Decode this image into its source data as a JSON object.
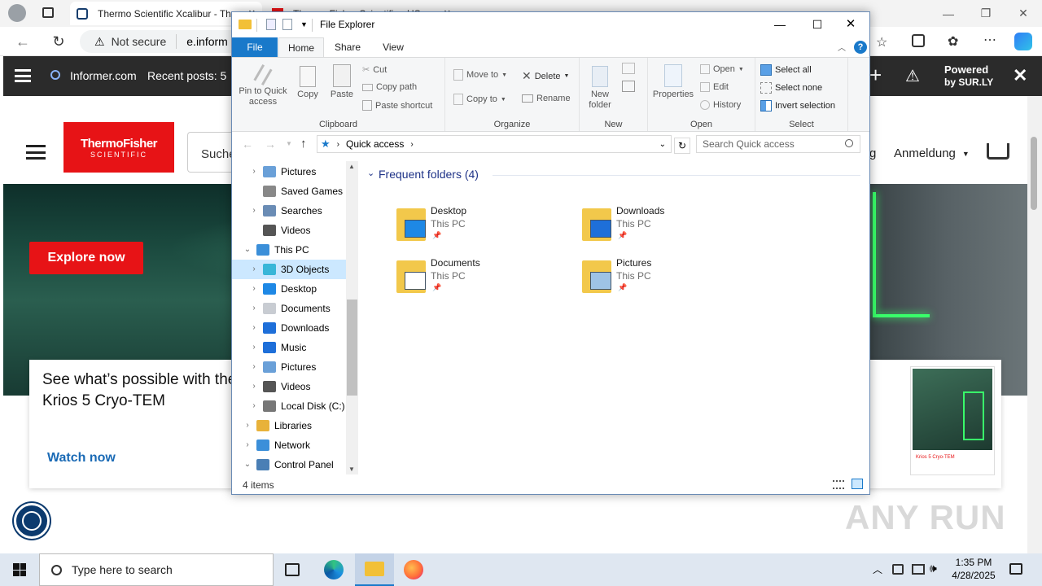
{
  "browser": {
    "tabs": [
      {
        "title": "Thermo Scientific Xcalibur - Th"
      },
      {
        "title": "Thermo Fisher Scientific - US"
      }
    ],
    "address": {
      "warning": "Not secure",
      "url": "e.inform"
    },
    "informer_bar": {
      "site": "Informer.com",
      "recent": "Recent posts: 5",
      "powered_line1": "Powered",
      "powered_line2": "by SUR.LY"
    },
    "site": {
      "logo_line1": "ThermoFisher",
      "logo_line2": "SCIENTIFIC",
      "search_placeholder": "Suche",
      "link_partial": "g",
      "signin": "Anmeldung",
      "hero_button": "Explore now",
      "card_title": "See what’s possible with the Krios 5 Cryo-TEM",
      "card_link": "Watch now",
      "product_caption": "Krios 5 Cryo-TEM"
    },
    "watermark": "ANY RUN"
  },
  "explorer": {
    "title": "File Explorer",
    "tabs": [
      "File",
      "Home",
      "Share",
      "View"
    ],
    "ribbon": {
      "clipboard": {
        "label": "Clipboard",
        "pin": "Pin to Quick access",
        "copy": "Copy",
        "paste": "Paste",
        "cut": "Cut",
        "copy_path": "Copy path",
        "paste_shortcut": "Paste shortcut"
      },
      "organize": {
        "label": "Organize",
        "move_to": "Move to",
        "copy_to": "Copy to",
        "delete": "Delete",
        "rename": "Rename"
      },
      "new": {
        "label": "New",
        "new_folder": "New folder"
      },
      "open": {
        "label": "Open",
        "properties": "Properties",
        "open": "Open",
        "edit": "Edit",
        "history": "History"
      },
      "select": {
        "label": "Select",
        "select_all": "Select all",
        "select_none": "Select none",
        "invert": "Invert selection"
      }
    },
    "address": {
      "path": "Quick access",
      "search_placeholder": "Search Quick access"
    },
    "tree": [
      {
        "label": "Pictures"
      },
      {
        "label": "Saved Games"
      },
      {
        "label": "Searches"
      },
      {
        "label": "Videos"
      },
      {
        "label": "This PC"
      },
      {
        "label": "3D Objects"
      },
      {
        "label": "Desktop"
      },
      {
        "label": "Documents"
      },
      {
        "label": "Downloads"
      },
      {
        "label": "Music"
      },
      {
        "label": "Pictures"
      },
      {
        "label": "Videos"
      },
      {
        "label": "Local Disk (C:)"
      },
      {
        "label": "Libraries"
      },
      {
        "label": "Network"
      },
      {
        "label": "Control Panel"
      }
    ],
    "section": "Frequent folders (4)",
    "folders": [
      {
        "name": "Desktop",
        "location": "This PC"
      },
      {
        "name": "Downloads",
        "location": "This PC"
      },
      {
        "name": "Documents",
        "location": "This PC"
      },
      {
        "name": "Pictures",
        "location": "This PC"
      }
    ],
    "status": "4 items"
  },
  "taskbar": {
    "search_placeholder": "Type here to search",
    "time": "1:35 PM",
    "date": "4/28/2025"
  },
  "colors": {
    "brand_red": "#e71316",
    "explorer_accent": "#1979ca",
    "selection": "#cce8ff"
  }
}
